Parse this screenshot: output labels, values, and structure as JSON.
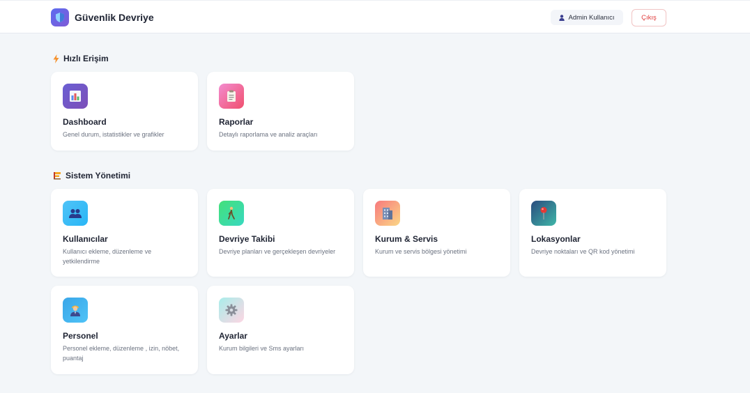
{
  "header": {
    "app_title": "Güvenlik Devriye",
    "user_label": "Admin Kullanıcı",
    "logout_label": "Çıkış"
  },
  "sections": {
    "quick_access": {
      "title": "Hızlı Erişim",
      "icon": "lightning-icon"
    },
    "system_management": {
      "title": "Sistem Yönetimi",
      "icon": "management-icon"
    }
  },
  "quick_cards": [
    {
      "title": "Dashboard",
      "desc": "Genel durum, istatistikler ve grafikler",
      "icon": "bar-chart-icon",
      "color_from": "#6a5fd3",
      "color_to": "#7d4fb8"
    },
    {
      "title": "Raporlar",
      "desc": "Detaylı raporlama ve analiz araçları",
      "icon": "clipboard-icon",
      "color_from": "#f38ccf",
      "color_to": "#f0506e"
    }
  ],
  "system_cards": [
    {
      "title": "Kullanıcılar",
      "desc": "Kullanıcı ekleme, düzenleme ve yetkilendirme",
      "icon": "users-icon",
      "color_from": "#4fc3f7",
      "color_to": "#29b6f6"
    },
    {
      "title": "Devriye Takibi",
      "desc": "Devriye planları ve gerçekleşen devriyeler",
      "icon": "walking-person-icon",
      "color_from": "#43e07a",
      "color_to": "#38d9c0"
    },
    {
      "title": "Kurum & Servis",
      "desc": "Kurum ve servis bölgesi yönetimi",
      "icon": "building-icon",
      "color_from": "#f7797d",
      "color_to": "#fbd786"
    },
    {
      "title": "Lokasyonlar",
      "desc": "Devriye noktaları ve QR kod yönetimi",
      "icon": "map-pin-icon",
      "color_from": "#2b4c7e",
      "color_to": "#3fb6a8"
    },
    {
      "title": "Personel",
      "desc": "Personel ekleme, düzenleme , izin, nöbet, puantaj",
      "icon": "staff-icon",
      "color_from": "#3aa6e8",
      "color_to": "#4fc3f7"
    },
    {
      "title": "Ayarlar",
      "desc": "Kurum bilgileri ve Sms ayarları",
      "icon": "gear-icon",
      "color_from": "#a8edea",
      "color_to": "#fed6e3"
    }
  ]
}
